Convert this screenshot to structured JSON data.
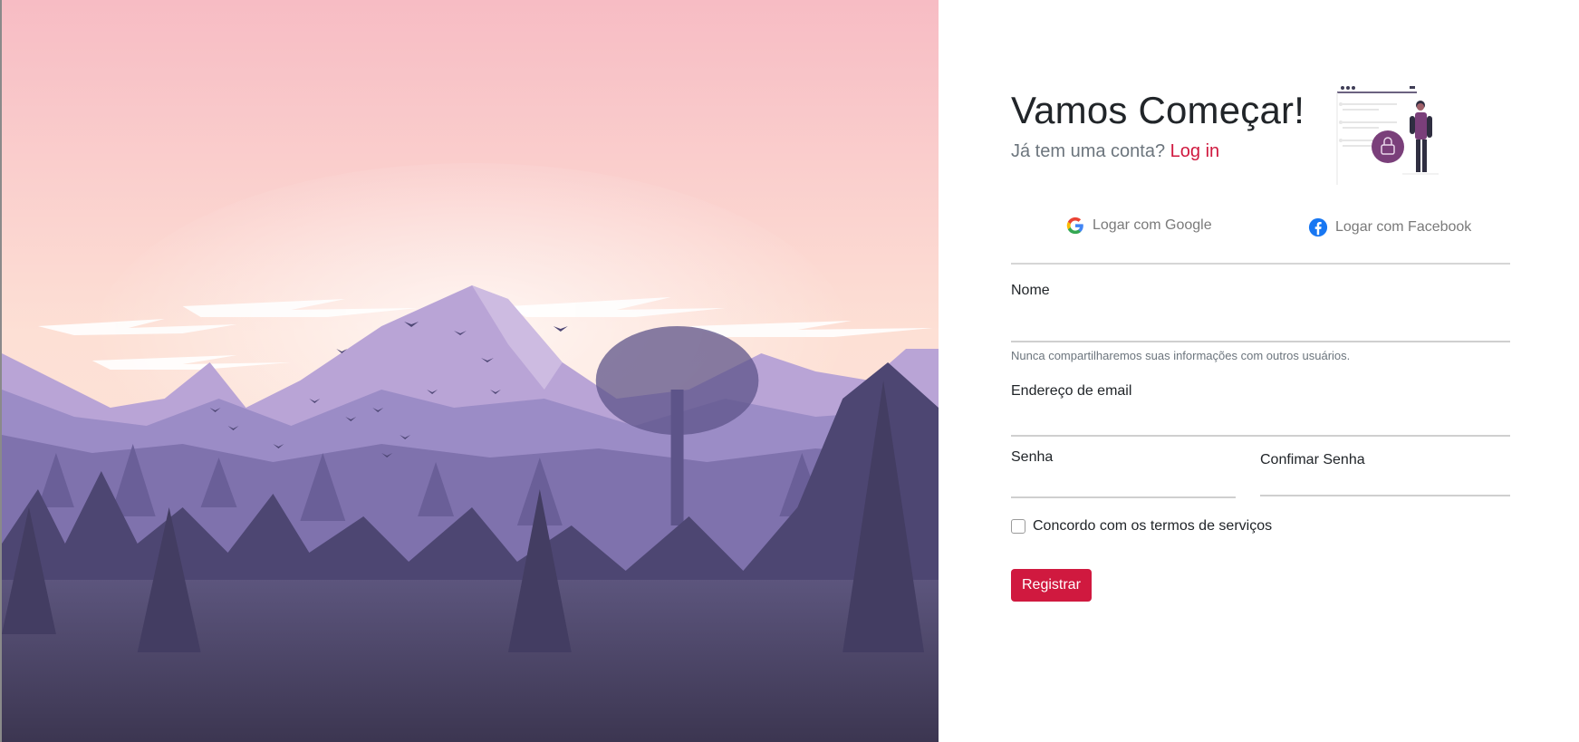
{
  "header": {
    "title": "Vamos Começar!",
    "subtitle_prefix": "Já tem uma conta?",
    "login_link": "Log in"
  },
  "social": {
    "google_label": "Logar com Google",
    "facebook_label": "Logar com Facebook"
  },
  "form": {
    "name_label": "Nome",
    "name_value": "",
    "name_help": "Nunca compartilharemos suas informações com outros usuários.",
    "email_label": "Endereço de email",
    "email_value": "",
    "password_label": "Senha",
    "password_value": "",
    "confirm_password_label": "Confimar Senha",
    "confirm_password_value": "",
    "terms_label": "Concordo com os termos de serviços",
    "terms_checked": false,
    "submit_label": "Registrar"
  },
  "colors": {
    "accent": "#d0193f",
    "facebook": "#1877f2",
    "sky_top": "#f7bcc4",
    "sky_bottom": "#fde2d4",
    "mountain": "#a08bc3",
    "forest_dark": "#3f3a57"
  },
  "icons": {
    "google": "google-icon",
    "facebook": "facebook-icon",
    "illustration": "person-with-webpage-illustration"
  }
}
